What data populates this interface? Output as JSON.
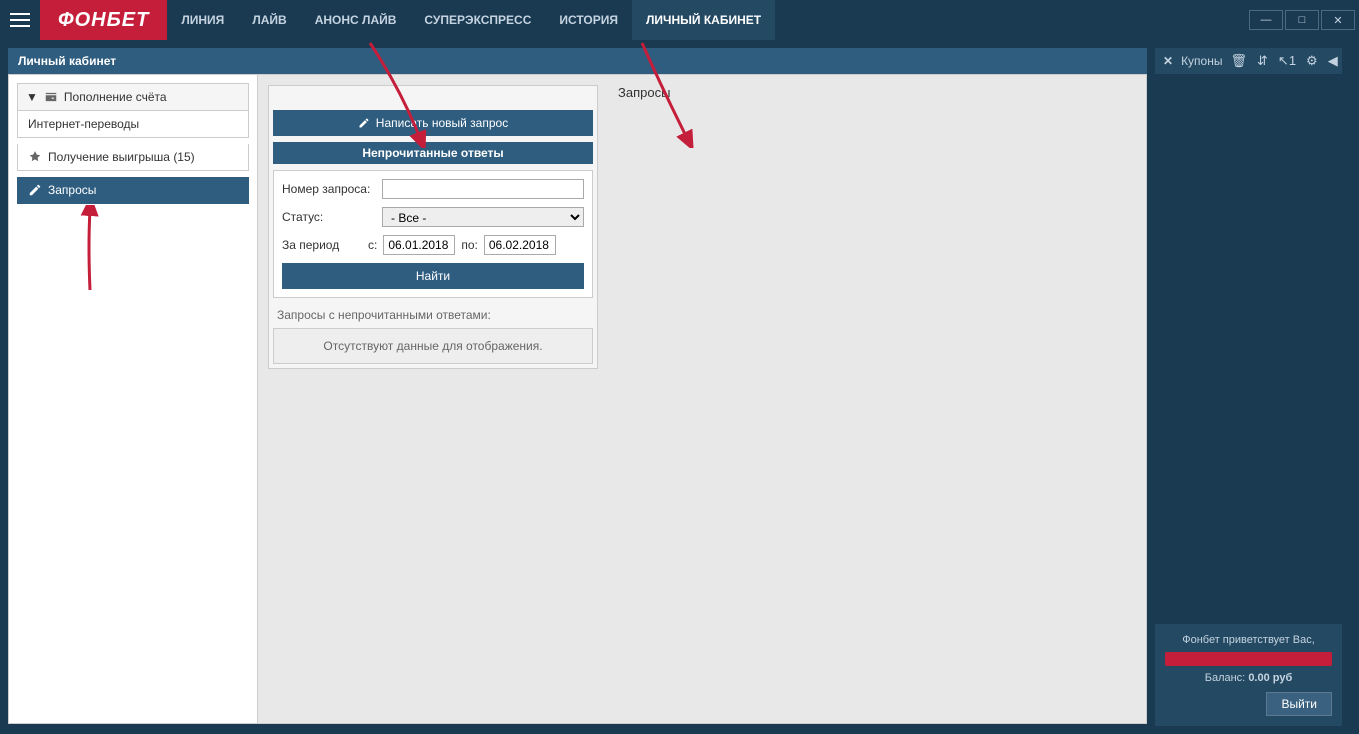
{
  "brand": "ФОНБЕТ",
  "nav": {
    "items": [
      {
        "label": "ЛИНИЯ"
      },
      {
        "label": "ЛАЙВ"
      },
      {
        "label": "АНОНС ЛАЙВ"
      },
      {
        "label": "СУПЕРЭКСПРЕСС"
      },
      {
        "label": "ИСТОРИЯ"
      },
      {
        "label": "ЛИЧНЫЙ КАБИНЕТ",
        "active": true
      }
    ]
  },
  "panel": {
    "title": "Личный кабинет"
  },
  "sidebar": {
    "group_header": "Пополнение счёта",
    "item_transfers": "Интернет-переводы",
    "item_payout": "Получение выигрыша (15)",
    "item_requests": "Запросы"
  },
  "content": {
    "requests_heading": "Запросы",
    "new_request_btn": "Написать новый запрос",
    "unread_header": "Непрочитанные ответы",
    "filter": {
      "req_number_label": "Номер запроса:",
      "req_number_value": "",
      "status_label": "Статус:",
      "status_value": "- Все -",
      "period_label": "За период",
      "from_label": "с:",
      "from_value": "06.01.2018",
      "to_label": "по:",
      "to_value": "06.02.2018",
      "search_btn": "Найти"
    },
    "unread_note": "Запросы с непрочитанными ответами:",
    "no_data": "Отсутствуют данные для отображения."
  },
  "coupons": {
    "label": "Купоны",
    "count": "1"
  },
  "user": {
    "greeting": "Фонбет приветствует Вас,",
    "balance_label": "Баланс:",
    "balance_value": "0.00 руб",
    "logout": "Выйти"
  }
}
